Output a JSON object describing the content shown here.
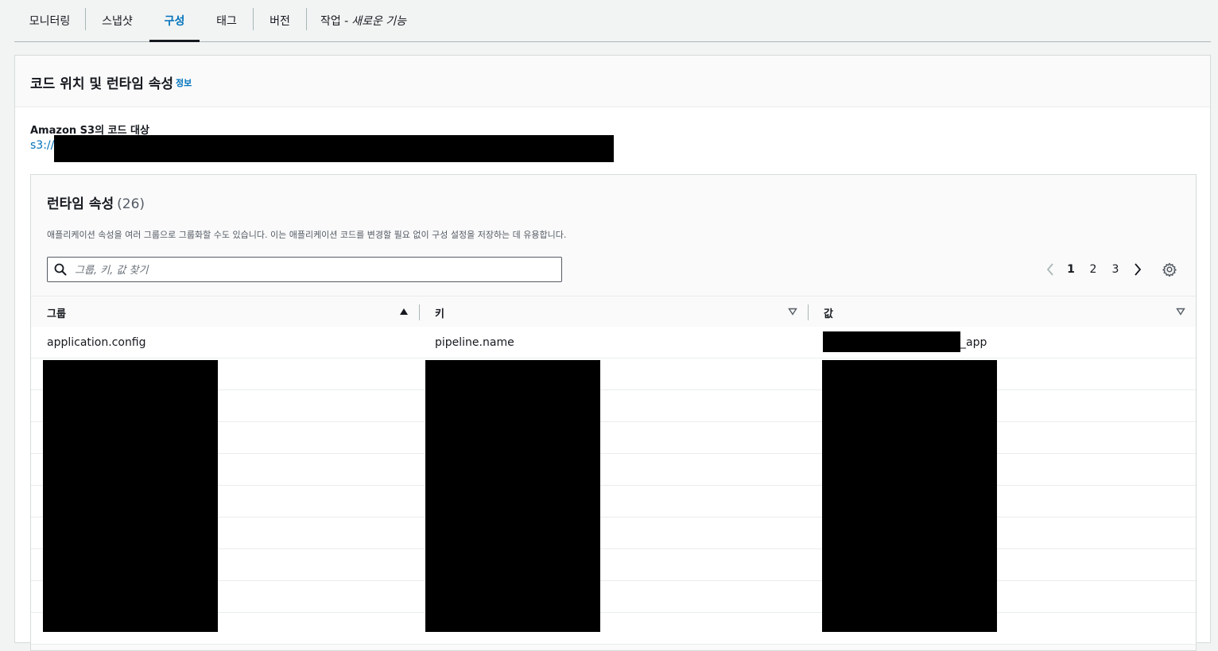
{
  "tabs": [
    {
      "label": "모니터링",
      "active": false
    },
    {
      "label": "스냅샷",
      "active": false
    },
    {
      "label": "구성",
      "active": true
    },
    {
      "label": "태그",
      "active": false
    },
    {
      "label": "버전",
      "active": false
    },
    {
      "label": "작업 -",
      "suffix": "새로운 기능",
      "active": false
    }
  ],
  "section": {
    "title": "코드 위치 및 런타임 속성",
    "info_link": "정보"
  },
  "s3": {
    "label": "Amazon S3의 코드 대상",
    "link_prefix": "s3://"
  },
  "runtime": {
    "title": "런타임 속성",
    "count": "(26)",
    "description": "애플리케이션 속성을 여러 그룹으로 그룹화할 수도 있습니다. 이는 애플리케이션 코드를 변경할 필요 없이 구성 설정을 저장하는 데 유용합니다.",
    "search_placeholder": "그룹, 키, 값 찾기",
    "pagination": {
      "pages": [
        "1",
        "2",
        "3"
      ],
      "current": "1"
    },
    "columns": [
      {
        "label": "그룹",
        "sort": "ascending"
      },
      {
        "label": "키",
        "sort": "none"
      },
      {
        "label": "값",
        "sort": "none"
      }
    ],
    "rows": [
      {
        "group": "application.config",
        "key": "pipeline.name",
        "value": "_app"
      }
    ]
  }
}
